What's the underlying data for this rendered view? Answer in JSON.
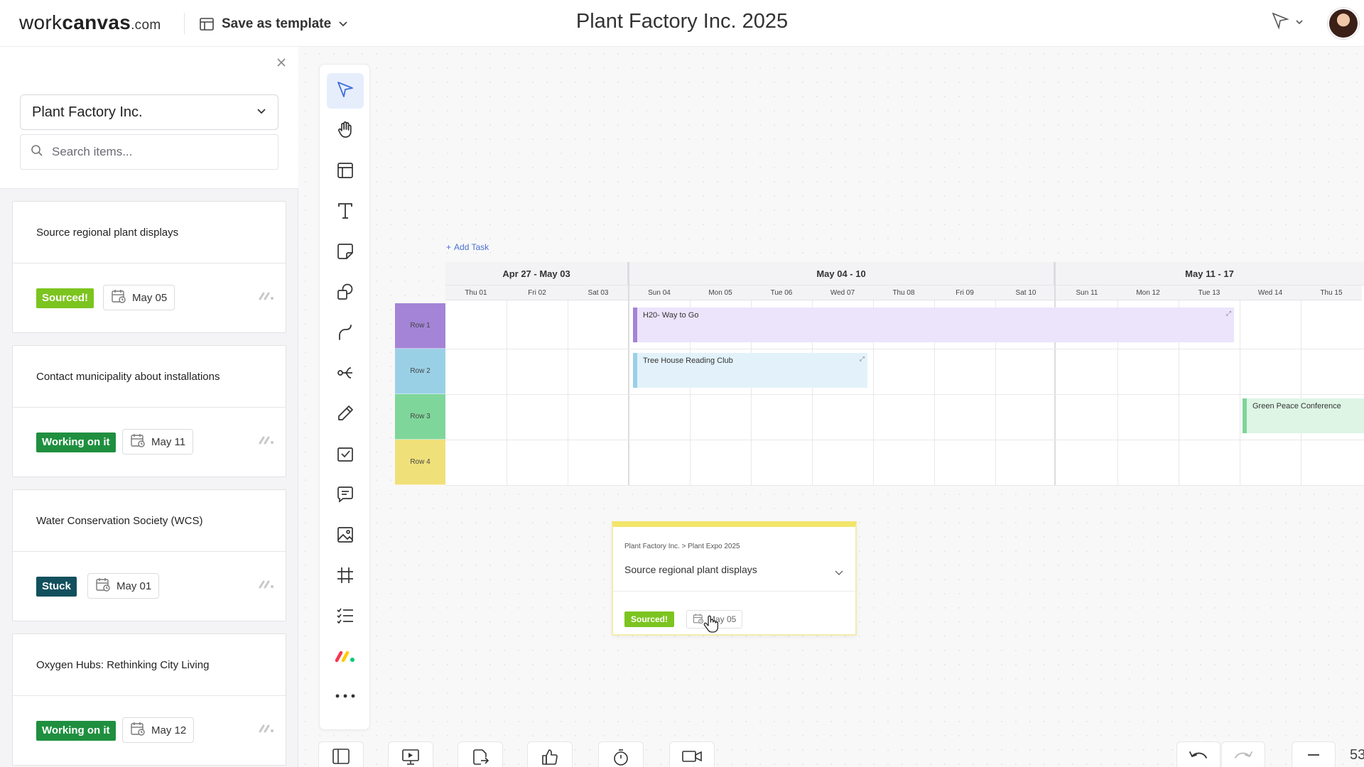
{
  "header": {
    "logo_prefix": "work",
    "logo_bold": "canvas",
    "logo_suffix": ".com",
    "save_template_label": "Save as template",
    "document_title": "Plant Factory Inc. 2025"
  },
  "left_panel": {
    "board_selected": "Plant Factory Inc.",
    "search_placeholder": "Search items...",
    "items": [
      {
        "title": "Source regional plant displays",
        "status": "Sourced!",
        "status_color": "#7cc41f",
        "date": "May 05"
      },
      {
        "title": "Contact municipality about installations",
        "status": "Working on it",
        "status_color": "#1f8f3f",
        "date": "May 11"
      },
      {
        "title": "Water Conservation Society (WCS)",
        "status": "Stuck",
        "status_color": "#12505d",
        "date": "May 01"
      },
      {
        "title": "Oxygen Hubs: Rethinking City Living",
        "status": "Working on it",
        "status_color": "#1f8f3f",
        "date": "May 12"
      }
    ]
  },
  "toolbar": {
    "tools": [
      "pointer-icon",
      "hand-icon",
      "layout-icon",
      "text-icon",
      "sticky-note-icon",
      "shapes-icon",
      "connector-icon",
      "mind-map-icon",
      "pencil-icon",
      "checkbox-icon",
      "comment-icon",
      "image-icon",
      "frame-icon",
      "list-icon",
      "monday-icon",
      "more-icon"
    ]
  },
  "timeline": {
    "add_task_label": "Add Task",
    "weeks": [
      "Apr 27 - May 03",
      "May 04 - 10",
      "May 11 - 17"
    ],
    "days": [
      "Thu 01",
      "Fri 02",
      "Sat 03",
      "Sun 04",
      "Mon 05",
      "Tue 06",
      "Wed 07",
      "Thu 08",
      "Fri 09",
      "Sat 10",
      "Sun 11",
      "Mon 12",
      "Tue 13",
      "Wed 14",
      "Thu 15"
    ],
    "rows": [
      {
        "label": "Row 1",
        "color": "#a384d6"
      },
      {
        "label": "Row 2",
        "color": "#9ad0e6"
      },
      {
        "label": "Row 3",
        "color": "#7fd69a"
      },
      {
        "label": "Row 4",
        "color": "#f0e07a"
      }
    ],
    "tasks": [
      {
        "name": "H20- Way to Go",
        "row": 1,
        "start_day": "Sun 04",
        "end_day": "Tue 13",
        "color": "#ece4fb",
        "border": "#a384d6"
      },
      {
        "name": "Tree House Reading Club",
        "row": 2,
        "start_day": "Sun 04",
        "end_day": "Wed 07",
        "color": "#e3f2fa",
        "border": "#9ad0e6"
      },
      {
        "name": "Green Peace Conference",
        "row": 3,
        "start_day": "Wed 14",
        "end_day": "Thu 15",
        "color": "#def5e5",
        "border": "#7fd69a"
      }
    ]
  },
  "float_card": {
    "breadcrumb": "Plant Factory Inc. > Plant Expo 2025",
    "title": "Source regional plant displays",
    "status": "Sourced!",
    "date": "May 05"
  },
  "bottom_bar": {
    "zoom": "53"
  }
}
